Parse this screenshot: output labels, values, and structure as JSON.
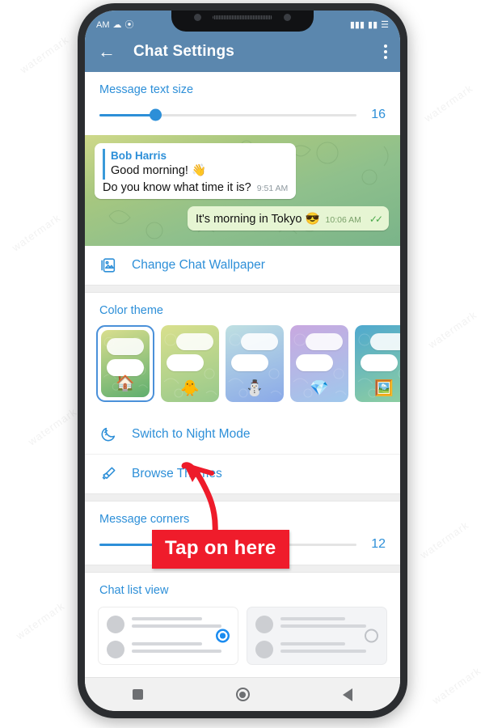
{
  "statusbar": {
    "left_text": "AM",
    "left_glyphs": [
      "☁",
      "⦿"
    ],
    "right_glyphs": [
      "▮▮▮",
      "▮▮",
      "☰"
    ]
  },
  "appbar": {
    "back_icon": "arrow-left-icon",
    "title": "Chat Settings",
    "overflow_icon": "more-vertical-icon",
    "bg_color": "#5b87ae"
  },
  "sections": {
    "message_text_size": {
      "label": "Message text size",
      "value": "16",
      "percent": 22
    },
    "message_corners": {
      "label": "Message corners",
      "value": "12",
      "percent": 70
    },
    "chat_list_view": {
      "label": "Chat list view"
    },
    "color_theme": {
      "label": "Color theme"
    }
  },
  "chat_preview": {
    "incoming": {
      "reply_author": "Bob Harris",
      "reply_text": "Good morning! 👋",
      "text": "Do you know what time it is?",
      "time": "9:51 AM"
    },
    "outgoing": {
      "text": "It's morning in Tokyo 😎",
      "time": "10:06 AM",
      "ticks": "✓✓"
    }
  },
  "rows": [
    {
      "label": "Change Chat Wallpaper",
      "icon": "image-icon"
    },
    {
      "label": "Switch to Night Mode",
      "icon": "moon-icon"
    },
    {
      "label": "Browse Themes",
      "icon": "paint-brush-icon"
    }
  ],
  "themes": [
    {
      "name": "green-house-theme",
      "emoji": "🏠",
      "selected": true,
      "c1": "#d9de8e",
      "c2": "#5fae6e"
    },
    {
      "name": "yellow-chick-theme",
      "emoji": "🐥",
      "selected": false,
      "c1": "#d9e08d",
      "c2": "#98c98c"
    },
    {
      "name": "blue-snowman-theme",
      "emoji": "⛄",
      "selected": false,
      "c1": "#bfe0e2",
      "c2": "#8aa9e8"
    },
    {
      "name": "purple-gem-theme",
      "emoji": "💎",
      "selected": false,
      "c1": "#c9a8e0",
      "c2": "#9fc8ec"
    },
    {
      "name": "teal-artist-theme",
      "emoji": "🖼️",
      "selected": false,
      "c1": "#4fa9cf",
      "c2": "#8fcf9f"
    }
  ],
  "chat_list_options": [
    {
      "name": "compact-list-option",
      "selected": true
    },
    {
      "name": "expanded-list-option",
      "selected": false
    }
  ],
  "navbar": {
    "recents": "square-recents-icon",
    "home": "circle-home-icon",
    "back": "triangle-back-icon"
  },
  "annotation": {
    "badge_text": "Tap on here",
    "badge_color": "#ef1c2b",
    "arrow": "curved-arrow-up"
  },
  "colors": {
    "accent": "#2d8fd8",
    "header": "#5b87ae",
    "red": "#ef1c2b"
  }
}
